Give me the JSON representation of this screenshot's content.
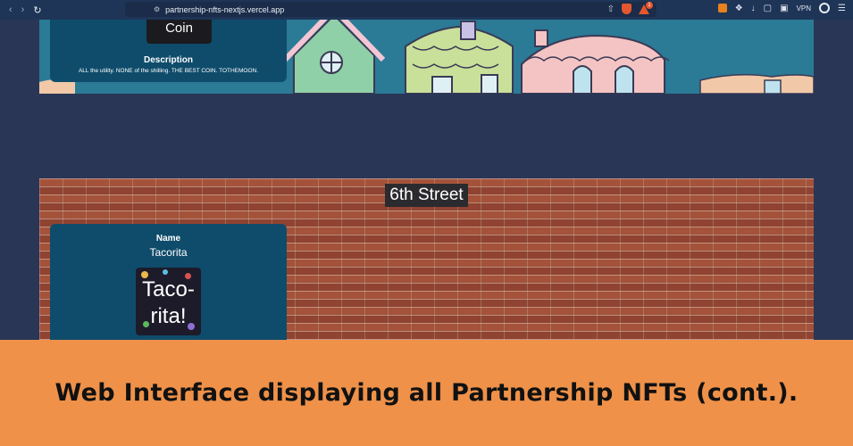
{
  "browser": {
    "url": "partnership-nfts-nextjs.vercel.app",
    "alert_count": "1",
    "vpn_label": "VPN"
  },
  "top_card": {
    "image_text": "Coin",
    "description_label": "Description",
    "description": "ALL the utility. NONE of the shilling. THE BEST COIN. TOTHEMOON."
  },
  "street": {
    "title": "6th Street",
    "card": {
      "name_label": "Name",
      "name": "Tacorita",
      "image_text_1": "Taco-",
      "image_text_2": "rita!"
    }
  },
  "caption": "Web Interface displaying all Partnership NFTs (cont.).",
  "colors": {
    "page_bg": "#2a3656",
    "card_bg": "#0f4c6b",
    "caption_bg": "#ef9149",
    "toolbar_bg": "#1f3557"
  }
}
